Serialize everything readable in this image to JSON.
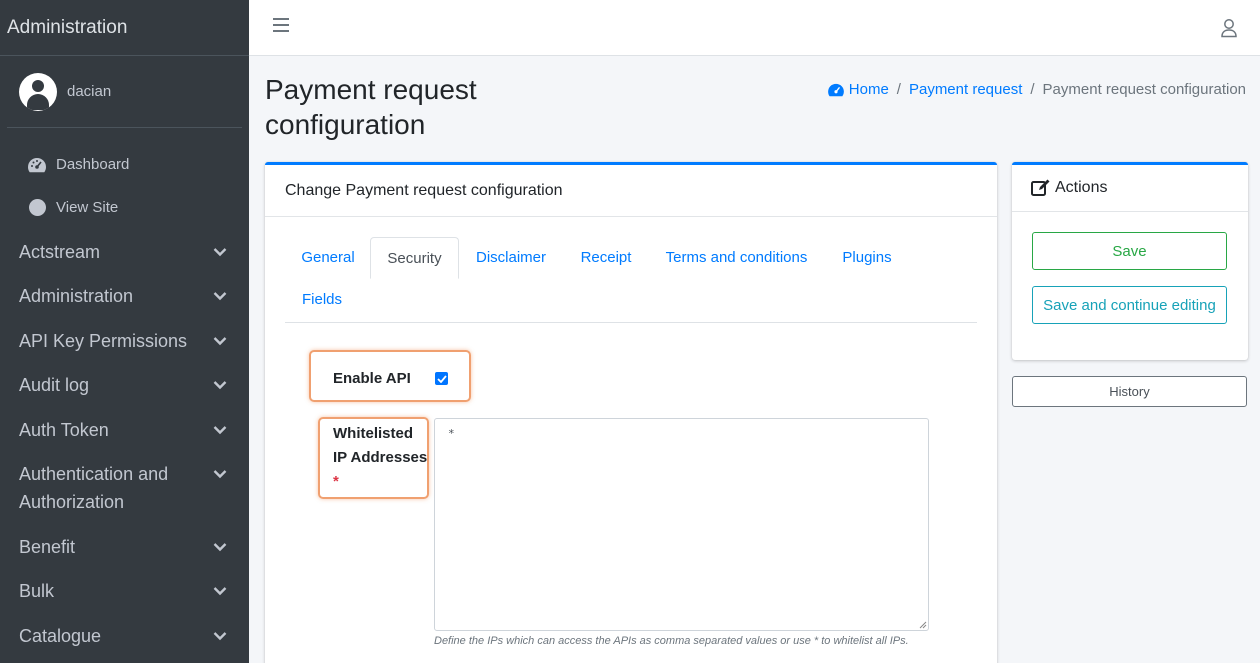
{
  "sidebar": {
    "brand": "Administration",
    "user_name": "dacian",
    "sub_links": [
      {
        "label": "Dashboard",
        "icon": "tachometer-icon"
      },
      {
        "label": "View Site",
        "icon": "circle-icon"
      }
    ],
    "items": [
      {
        "label": "Actstream"
      },
      {
        "label": "Administration"
      },
      {
        "label": "API Key Permissions"
      },
      {
        "label": "Audit log"
      },
      {
        "label": "Auth Token"
      },
      {
        "label": "Authentication and Authorization"
      },
      {
        "label": "Benefit"
      },
      {
        "label": "Bulk"
      },
      {
        "label": "Catalogue"
      }
    ]
  },
  "header": {
    "title": "Payment request configuration",
    "breadcrumb": {
      "home": "Home",
      "parent": "Payment request",
      "current": "Payment request configuration"
    }
  },
  "form": {
    "card_title": "Change Payment request configuration",
    "tabs": [
      "General",
      "Security",
      "Disclaimer",
      "Receipt",
      "Terms and conditions",
      "Plugins",
      "Fields"
    ],
    "active_tab": "Security",
    "enable_api_label": "Enable API",
    "enable_api_checked": true,
    "whitelist_label": "Whitelisted IP Addresses",
    "whitelist_required_mark": "*",
    "whitelist_value": "*",
    "whitelist_help": "Define the IPs which can access the APIs as comma separated values or use * to whitelist all IPs."
  },
  "actions": {
    "title": "Actions",
    "save_label": "Save",
    "save_continue_label": "Save and continue editing",
    "history_label": "History"
  },
  "colors": {
    "sidebar_bg": "#343a40",
    "primary": "#007bff",
    "success": "#28a745",
    "info": "#17a2b8",
    "highlight": "#f0a070"
  }
}
